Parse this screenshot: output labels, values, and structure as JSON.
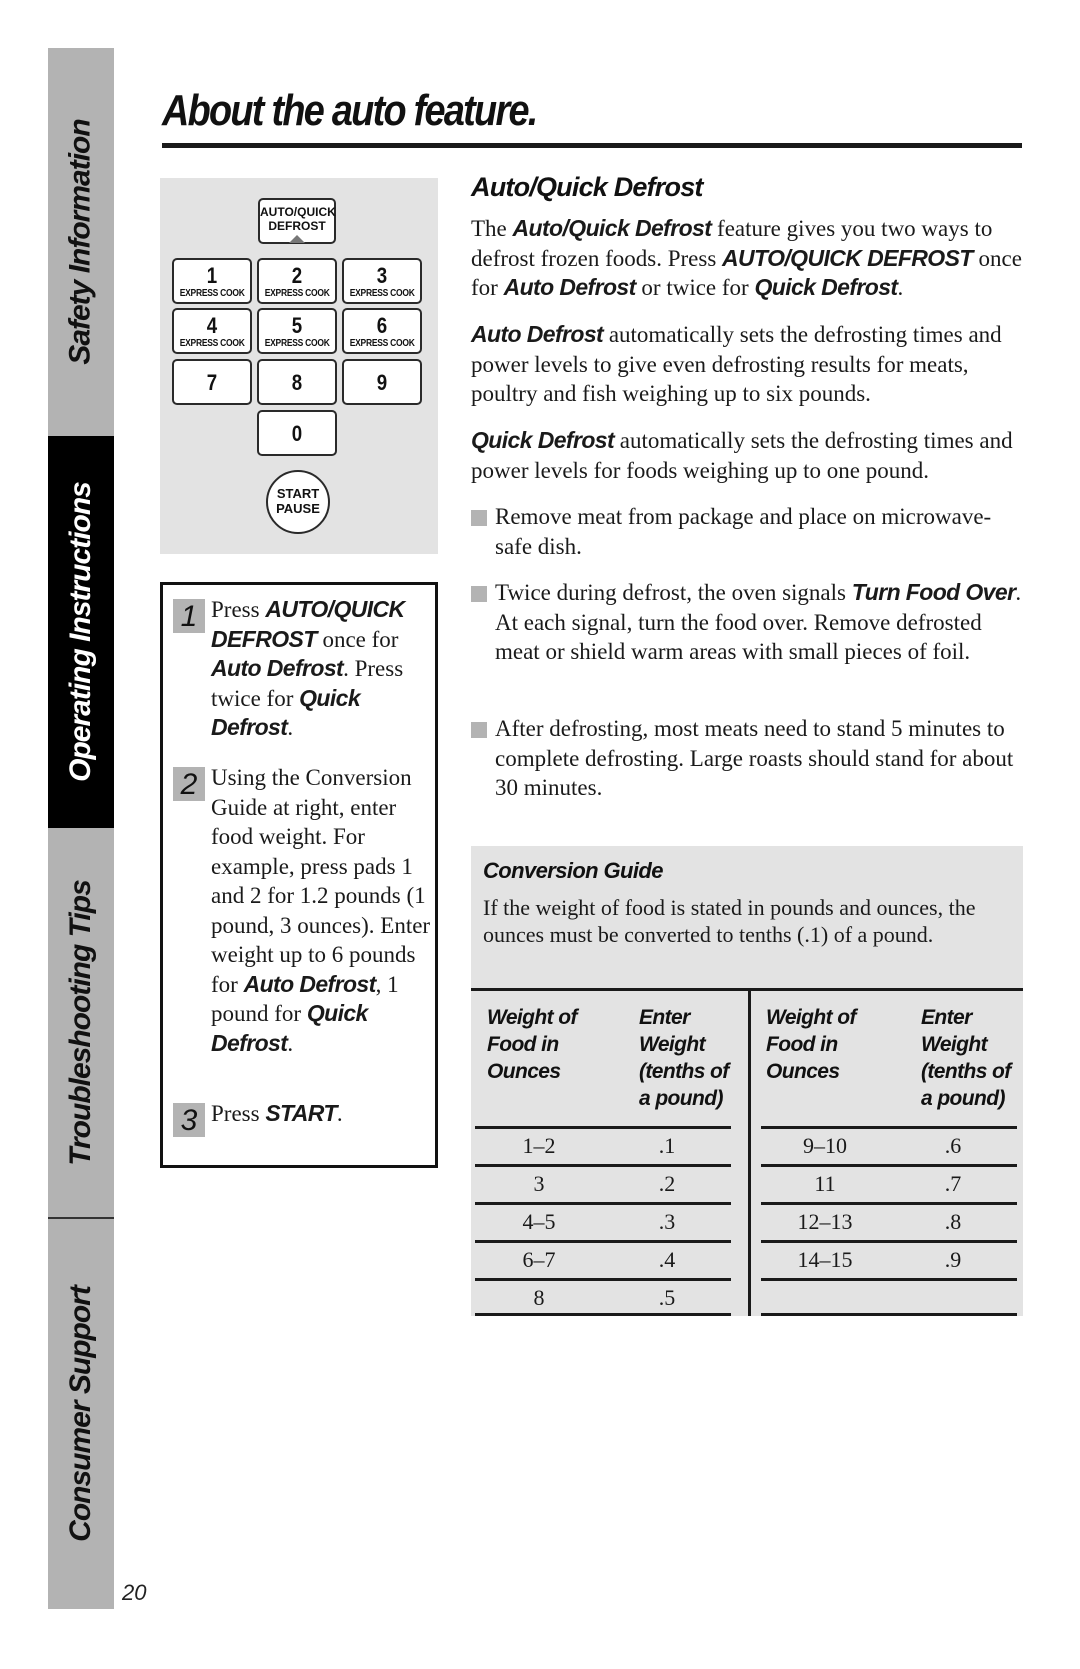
{
  "side_tabs": [
    {
      "label": "Safety Information",
      "active": false
    },
    {
      "label": "Operating Instructions",
      "active": true
    },
    {
      "label": "Troubleshooting Tips",
      "active": false
    },
    {
      "label": "Consumer Support",
      "active": false
    }
  ],
  "page_number": "20",
  "title": "About the auto feature.",
  "keypad": {
    "defrost_key": {
      "line1": "AUTO/QUICK",
      "line2": "DEFROST"
    },
    "number_keys": [
      {
        "num": "1",
        "sub": "EXPRESS COOK"
      },
      {
        "num": "2",
        "sub": "EXPRESS COOK"
      },
      {
        "num": "3",
        "sub": "EXPRESS COOK"
      },
      {
        "num": "4",
        "sub": "EXPRESS COOK"
      },
      {
        "num": "5",
        "sub": "EXPRESS COOK"
      },
      {
        "num": "6",
        "sub": "EXPRESS COOK"
      },
      {
        "num": "7",
        "sub": ""
      },
      {
        "num": "8",
        "sub": ""
      },
      {
        "num": "9",
        "sub": ""
      },
      {
        "num": "0",
        "sub": ""
      }
    ],
    "start_key": {
      "line1": "START",
      "line2": "PAUSE"
    }
  },
  "steps": [
    {
      "number": "1",
      "parts": [
        "Press ",
        "AUTO/QUICK DEFROST",
        " once for ",
        "Auto Defrost",
        ". Press twice for ",
        "Quick Defrost",
        "."
      ]
    },
    {
      "number": "2",
      "parts": [
        "Using the Conversion Guide at right, enter food weight. For example, press pads 1 and 2 for 1.2 pounds (1 pound, 3 ounces). Enter weight up to 6 pounds for ",
        "Auto Defrost",
        ", 1 pound for ",
        "Quick Defrost",
        "."
      ]
    },
    {
      "number": "3",
      "parts": [
        "Press ",
        "START",
        "."
      ]
    }
  ],
  "section": {
    "heading": "Auto/Quick Defrost",
    "intro": [
      "The ",
      "Auto/Quick Defrost",
      " feature gives you two ways to defrost frozen foods. Press ",
      "AUTO/QUICK DEFROST",
      " once for ",
      "Auto Defrost",
      " or twice for ",
      "Quick Defrost",
      "."
    ],
    "auto_para": [
      "Auto Defrost",
      " automatically sets the defrosting times and power levels to give even defrosting results for meats, poultry and fish weighing up to six pounds."
    ],
    "quick_para": [
      "Quick Defrost",
      " automatically sets the defrosting times and power levels for foods weighing up to one pound."
    ],
    "bullets": [
      [
        "Remove meat from package and place on microwave-safe dish."
      ],
      [
        "Twice during defrost, the oven signals ",
        "Turn Food Over",
        ". At each signal, turn the food over. Remove defrosted meat or shield warm areas with small pieces of foil."
      ],
      [
        "After defrosting, most meats need to stand 5 minutes to complete defrosting. Large roasts should stand for about 30 minutes."
      ]
    ]
  },
  "conversion_guide": {
    "title": "Conversion Guide",
    "description": "If the weight of food is stated in pounds and ounces, the ounces must be converted to tenths (.1) of a pound.",
    "col_weight": "Weight of Food in Ounces",
    "col_enter": "Enter Weight (tenths of a pound)",
    "left_rows": [
      {
        "ounces": "1–2",
        "enter": ".1"
      },
      {
        "ounces": "3",
        "enter": ".2"
      },
      {
        "ounces": "4–5",
        "enter": ".3"
      },
      {
        "ounces": "6–7",
        "enter": ".4"
      },
      {
        "ounces": "8",
        "enter": ".5"
      }
    ],
    "right_rows": [
      {
        "ounces": "9–10",
        "enter": ".6"
      },
      {
        "ounces": "11",
        "enter": ".7"
      },
      {
        "ounces": "12–13",
        "enter": ".8"
      },
      {
        "ounces": "14–15",
        "enter": ".9"
      },
      {
        "ounces": "",
        "enter": ""
      }
    ]
  }
}
